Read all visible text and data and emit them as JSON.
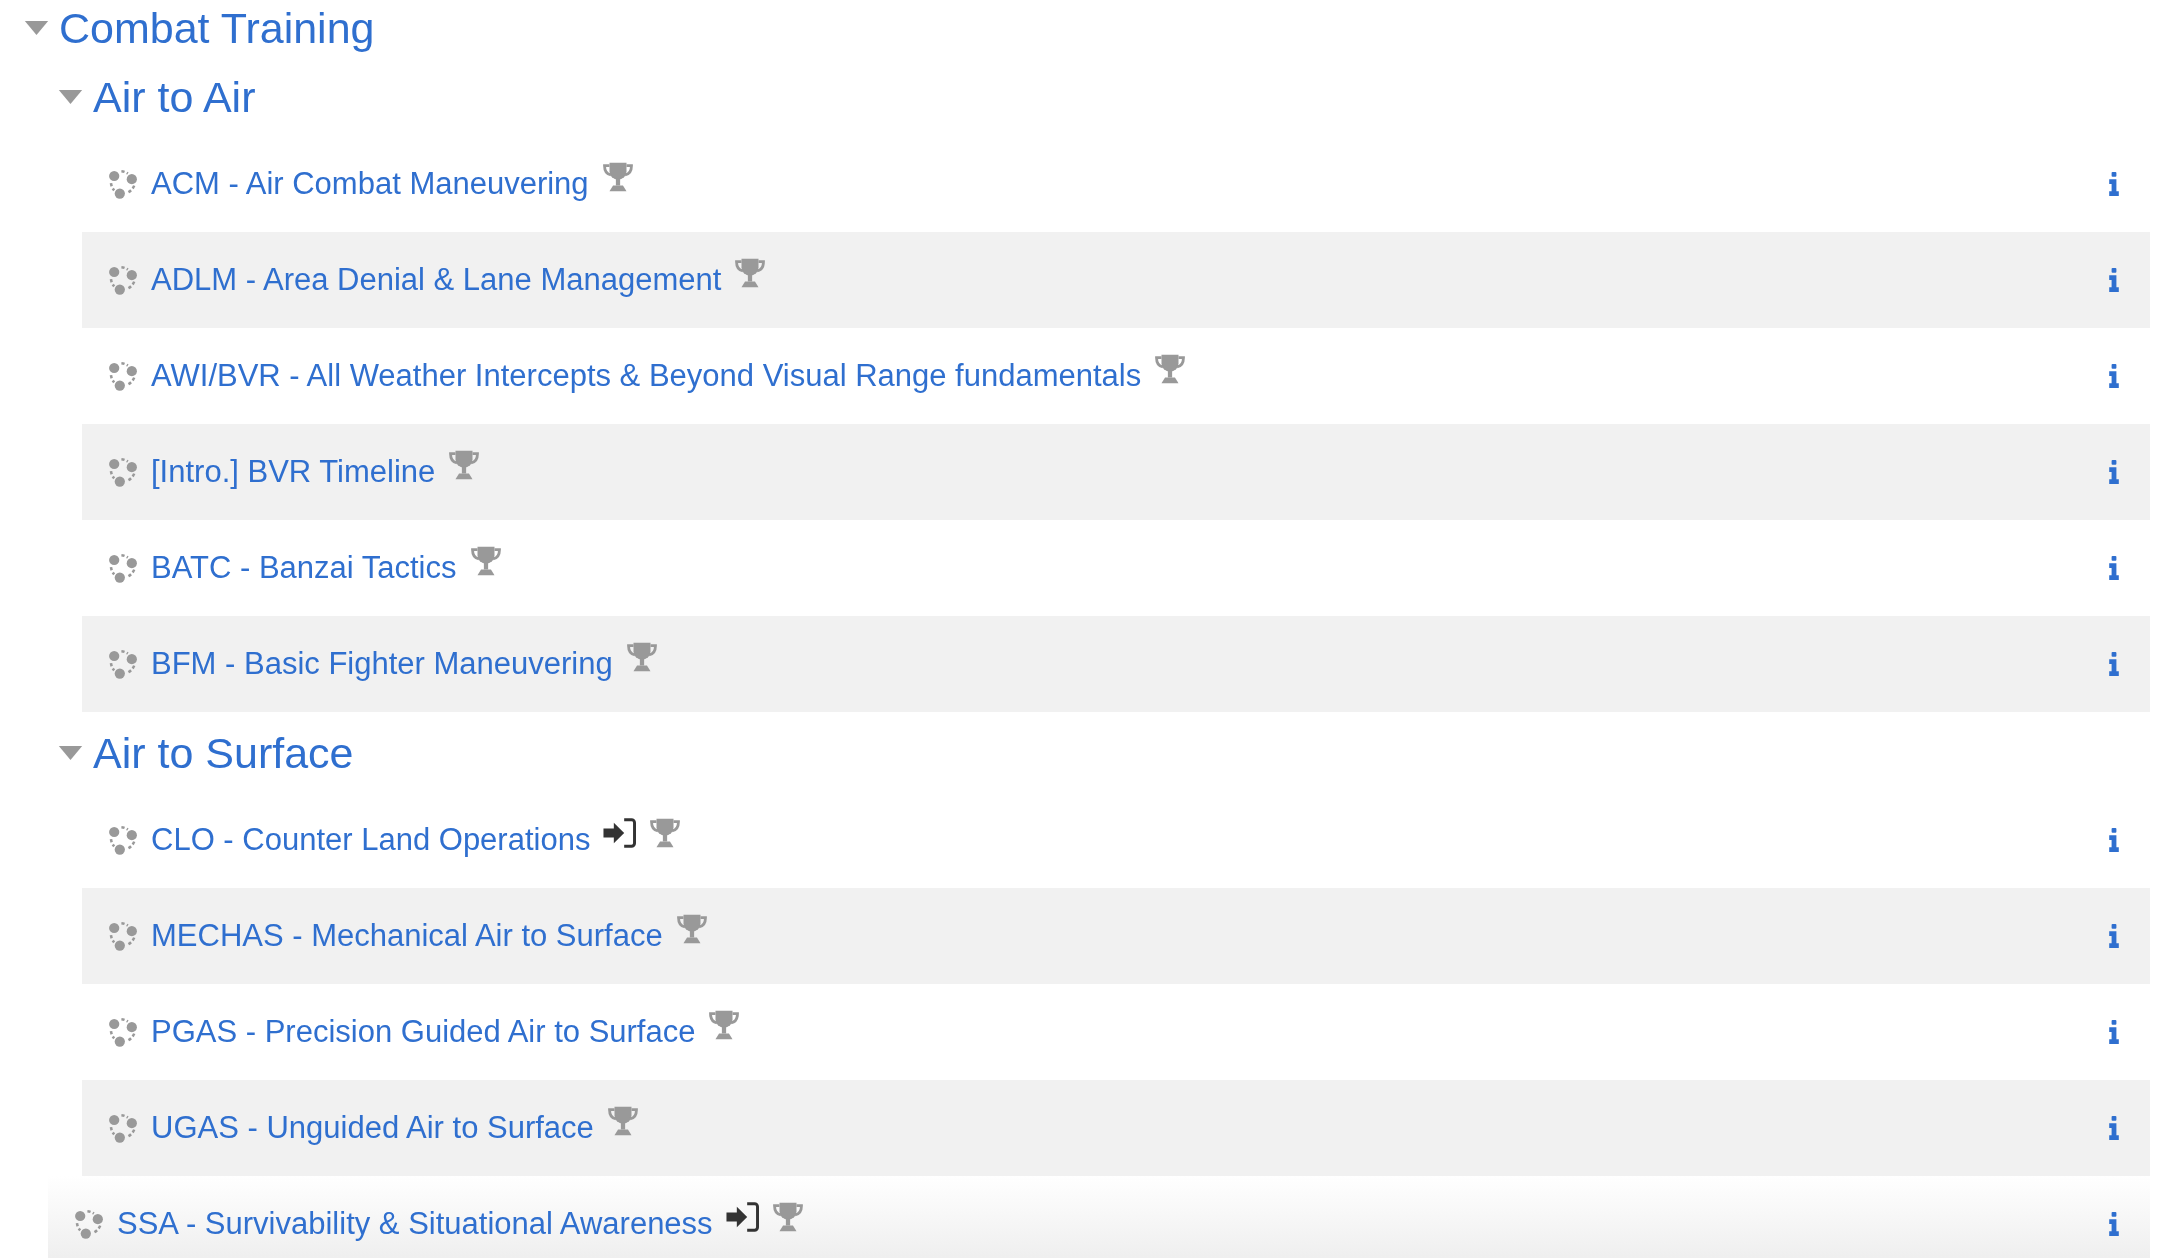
{
  "tree": {
    "kind": "section",
    "label": "Combat Training",
    "expanded": true,
    "children": [
      {
        "kind": "section",
        "label": "Air to Air",
        "expanded": true,
        "children": [
          {
            "kind": "activity",
            "label": "ACM - Air Combat Maneuvering",
            "enter_mark": false
          },
          {
            "kind": "activity",
            "label": "ADLM - Area Denial & Lane Management",
            "enter_mark": false
          },
          {
            "kind": "activity",
            "label": "AWI/BVR - All Weather Intercepts & Beyond Visual Range fundamentals",
            "enter_mark": false
          },
          {
            "kind": "activity",
            "label": "[Intro.] BVR Timeline",
            "enter_mark": false
          },
          {
            "kind": "activity",
            "label": "BATC - Banzai Tactics",
            "enter_mark": false
          },
          {
            "kind": "activity",
            "label": "BFM - Basic Fighter Maneuvering",
            "enter_mark": false
          }
        ]
      },
      {
        "kind": "section",
        "label": "Air to Surface",
        "expanded": true,
        "children": [
          {
            "kind": "activity",
            "label": "CLO - Counter Land Operations",
            "enter_mark": true
          },
          {
            "kind": "activity",
            "label": "MECHAS - Mechanical Air to Surface",
            "enter_mark": false
          },
          {
            "kind": "activity",
            "label": "PGAS - Precision Guided Air to Surface",
            "enter_mark": false
          },
          {
            "kind": "activity",
            "label": "UGAS - Unguided Air to Surface",
            "enter_mark": false
          }
        ]
      },
      {
        "kind": "activity",
        "label": "SSA - Survivability & Situational Awareness",
        "enter_mark": true
      }
    ]
  }
}
